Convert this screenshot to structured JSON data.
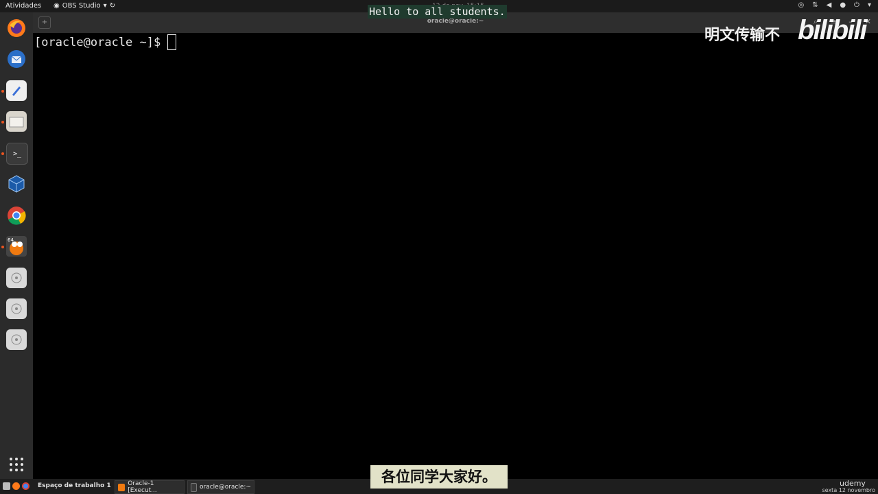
{
  "topbar": {
    "activities": "Atividades",
    "app_name": "OBS Studio",
    "clock": "12 de nov. 15:15"
  },
  "terminal": {
    "title": "oracle@oracle:~",
    "prompt": "[oracle@oracle ~]$"
  },
  "subtitles": {
    "english": "Hello to all students.",
    "chinese": "各位同学大家好。"
  },
  "watermark": {
    "text": "明文传输不",
    "logo": "bilibili"
  },
  "dock": {
    "items": [
      "firefox-icon",
      "thunderbird-icon",
      "text-editor-icon",
      "files-icon",
      "terminal-icon",
      "virtualbox-icon",
      "chrome-icon",
      "game-icon",
      "disk-icon",
      "disk-icon",
      "disk-icon"
    ],
    "show_apps": "show-applications-icon"
  },
  "taskbar": {
    "workspace": "Espaço de trabalho 1",
    "tasks": [
      "Oracle-1 [Execut...",
      "oracle@oracle:~"
    ],
    "brand": "udemy",
    "date": "sexta 12 novembro"
  },
  "colors": {
    "accent": "#e95420",
    "terminal_bg": "#000000",
    "subtitle_en_bg": "#1f3b2e",
    "subtitle_cn_bg": "#e2e2c8"
  }
}
